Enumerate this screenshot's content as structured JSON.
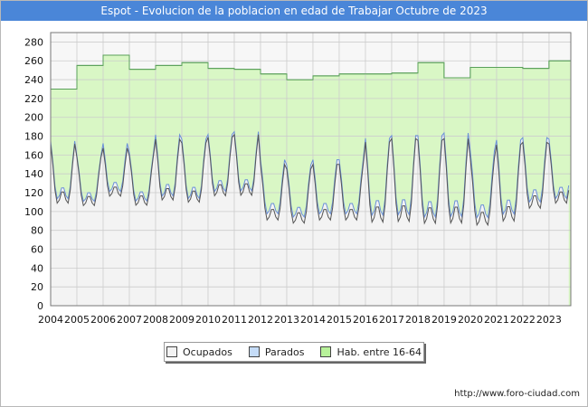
{
  "header": {
    "title": "Espot - Evolucion de la poblacion en edad de Trabajar Octubre de 2023"
  },
  "footer": {
    "source": "http://www.foro-ciudad.com"
  },
  "colors": {
    "title_bar": "#4a86d8",
    "hab_fill": "#d9f7c5",
    "hab_line": "#5aa05a",
    "parados_fill": "#f3f3f3",
    "parados_line": "#6a8fd8",
    "ocupados_line": "#555555",
    "grid": "#cccccc"
  },
  "chart_data": {
    "type": "area",
    "title": "Espot - Evolucion de la poblacion en edad de Trabajar Octubre de 2023",
    "xlabel": "",
    "ylabel": "",
    "ylim": [
      0,
      290
    ],
    "xlim": [
      2004,
      2023.83
    ],
    "y_ticks": [
      "0",
      "20",
      "40",
      "60",
      "80",
      "100",
      "120",
      "140",
      "160",
      "180",
      "200",
      "220",
      "240",
      "260",
      "280"
    ],
    "x_ticks": [
      "2004",
      "2005",
      "2006",
      "2007",
      "2008",
      "2009",
      "2010",
      "2011",
      "2012",
      "2013",
      "2014",
      "2015",
      "2016",
      "2017",
      "2018",
      "2019",
      "2020",
      "2021",
      "2022",
      "2023"
    ],
    "grid": true,
    "legend_position": "bottom",
    "series": [
      {
        "name": "Hab. entre 16-64",
        "key": "hab",
        "years": [
          2004,
          2005,
          2006,
          2007,
          2008,
          2009,
          2010,
          2011,
          2012,
          2013,
          2014,
          2015,
          2016,
          2017,
          2018,
          2019,
          2020,
          2021,
          2022,
          2023
        ],
        "values": [
          230,
          255,
          266,
          251,
          255,
          258,
          252,
          251,
          246,
          240,
          244,
          246,
          246,
          247,
          258,
          242,
          253,
          253,
          252,
          260
        ]
      },
      {
        "name": "Parados",
        "key": "parados",
        "years": [
          2004,
          2005,
          2006,
          2007,
          2008,
          2009,
          2010,
          2011,
          2012,
          2013,
          2014,
          2015,
          2016,
          2017,
          2018,
          2019,
          2020,
          2021,
          2022,
          2023
        ],
        "peak": [
          178,
          162,
          175,
          165,
          185,
          180,
          185,
          188,
          158,
          152,
          158,
          158,
          182,
          185,
          185,
          188,
          168,
          180,
          182,
          180
        ],
        "low": [
          100,
          100,
          110,
          100,
          102,
          100,
          108,
          108,
          85,
          82,
          85,
          85,
          78,
          78,
          75,
          75,
          78,
          80,
          95,
          100
        ]
      },
      {
        "name": "Ocupados",
        "key": "ocupados",
        "years": [
          2004,
          2005,
          2006,
          2007,
          2008,
          2009,
          2010,
          2011,
          2012,
          2013,
          2014,
          2015,
          2016,
          2017,
          2018,
          2019,
          2020,
          2021,
          2022,
          2023
        ],
        "peak": [
          175,
          160,
          170,
          162,
          180,
          176,
          182,
          185,
          153,
          148,
          153,
          153,
          178,
          182,
          180,
          182,
          160,
          175,
          177,
          175
        ],
        "low": [
          95,
          95,
          105,
          95,
          98,
          96,
          103,
          103,
          78,
          75,
          78,
          78,
          70,
          70,
          68,
          68,
          70,
          72,
          88,
          95
        ]
      }
    ]
  },
  "legend": {
    "items": [
      {
        "label": "Ocupados",
        "color": "#f3f3f3"
      },
      {
        "label": "Parados",
        "color": "#c5dcf8"
      },
      {
        "label": "Hab. entre 16-64",
        "color": "#b8f29a"
      }
    ]
  }
}
